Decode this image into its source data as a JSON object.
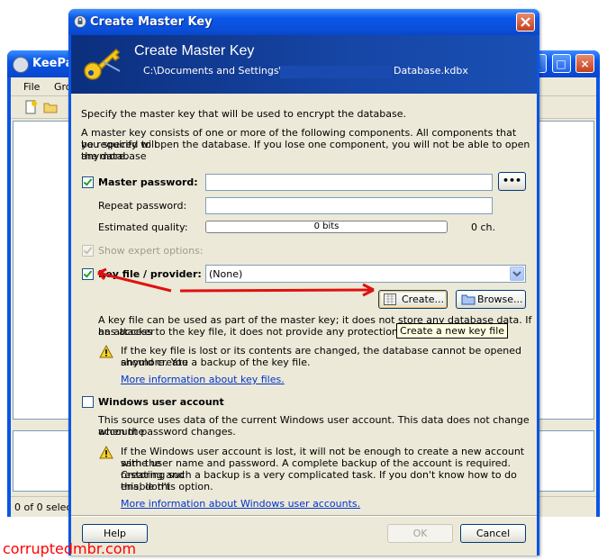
{
  "background_window": {
    "title": "KeePas",
    "menu": [
      "File",
      "Gro"
    ],
    "status": "0 of 0 selecte"
  },
  "dialog": {
    "title": "Create Master Key",
    "banner_title": "Create Master Key",
    "path_start": "C:\\Documents and Settings\\",
    "path_end": "Database.kdbx",
    "intro": "Specify the master key that will be used to encrypt the database.",
    "components_line1": "A master key consists of one or more of the following components. All components that you specify will",
    "components_line2": "be required to open the database. If you lose one component, you will not be able to open the database",
    "components_line3": "anymore.",
    "master_password": {
      "label": "Master password:",
      "checked": true,
      "value": "",
      "show_button": "•••",
      "repeat_label": "Repeat password:",
      "repeat_value": "",
      "quality_label": "Estimated quality:",
      "quality_value": "0 bits",
      "quality_fraction": 0,
      "chars": "0 ch."
    },
    "expert_options": {
      "label": "Show expert options:",
      "checked": true,
      "disabled": true
    },
    "key_file": {
      "label": "Key file / provider:",
      "checked": true,
      "selected": "(None)",
      "create_button": "Create...",
      "browse_button": "Browse...",
      "tooltip": "Create a new key file",
      "desc_line1": "A key file can be used as part of the master key; it does not store any database data. If an attacker",
      "desc_line2": "has access to the key file, it does not provide any protection.",
      "warn_line1": "If the key file is lost or its contents are changed, the database cannot be opened anymore. You",
      "warn_line2": "should create a backup of the key file.",
      "more_link": "More information about key files."
    },
    "windows_account": {
      "label": "Windows user account",
      "checked": false,
      "desc_line1": "This source uses data of the current Windows user account. This data does not change when the",
      "desc_line2": "account password changes.",
      "warn_line1": "If the Windows user account is lost, it will not be enough to create a new account with the",
      "warn_line2": "same user name and password. A complete backup of the account is required. Creating and",
      "warn_line3": "restoring such a backup is a very complicated task. If you don't know how to do this, don't",
      "warn_line4": "enable this option.",
      "more_link": "More information about Windows user accounts."
    },
    "buttons": {
      "help": "Help",
      "ok": "OK",
      "cancel": "Cancel"
    }
  },
  "watermark": "corruptedmbr.com",
  "colors": {
    "title_blue": "#0a55e4",
    "dialog_bg": "#ece9d8",
    "arrow_red": "#e01010",
    "link": "#0033cc"
  }
}
